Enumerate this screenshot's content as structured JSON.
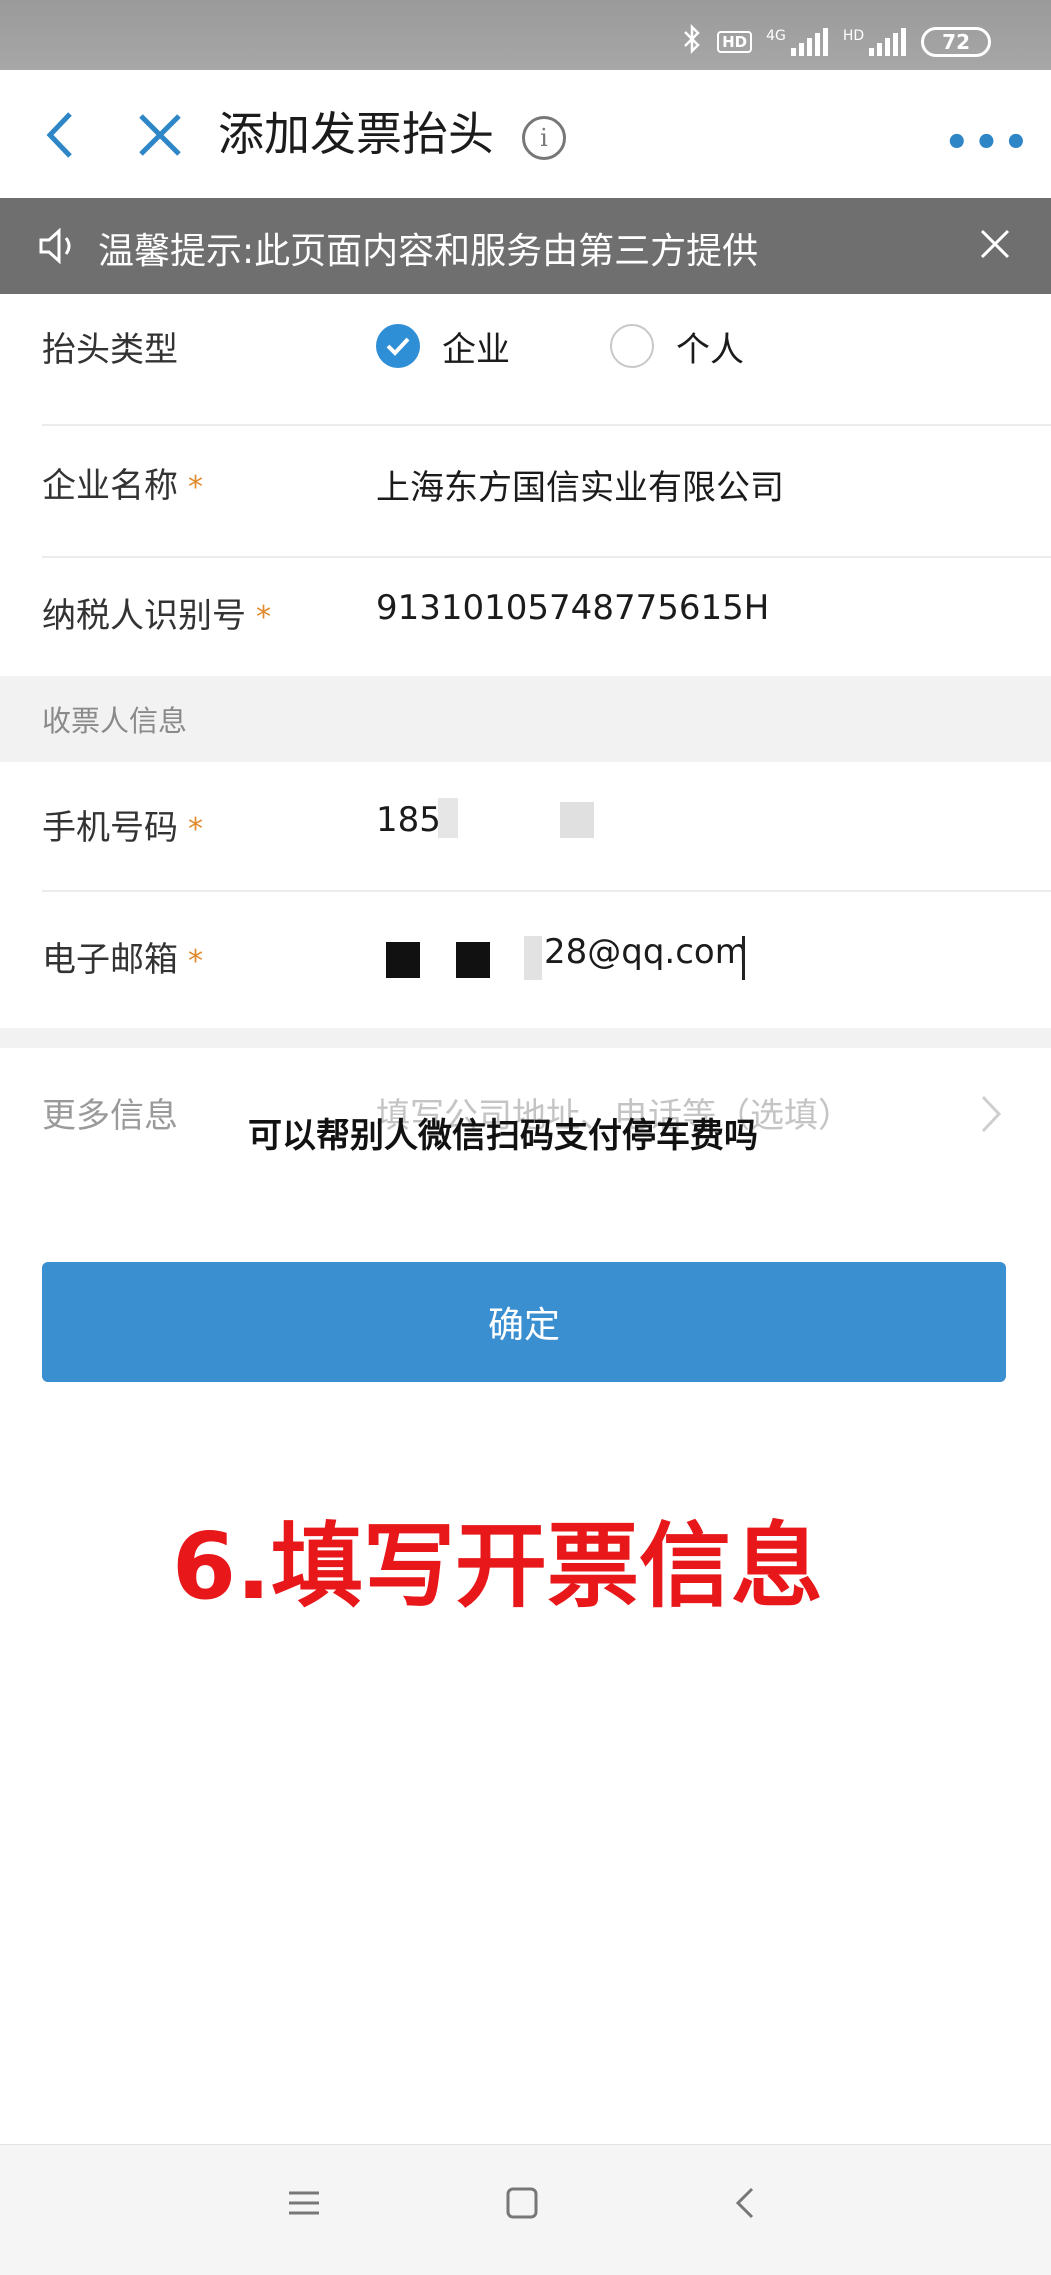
{
  "status_bar": {
    "signal1_label": "4G",
    "signal2_label": "HD",
    "hd_label": "HD",
    "battery": "72",
    "icons": [
      "bluetooth-icon",
      "hd-icon",
      "signal-icon",
      "signal-icon",
      "battery-icon"
    ]
  },
  "header": {
    "title": "添加发票抬头",
    "info_glyph": "i",
    "more_glyph": "•••"
  },
  "notice": {
    "text": "温馨提示:此页面内容和服务由第三方提供"
  },
  "form": {
    "type_label": "抬头类型",
    "option_company": "企业",
    "option_personal": "个人",
    "selected": "企业",
    "company_label": "企业名称",
    "company_value": "上海东方国信实业有限公司",
    "tax_label": "纳税人识别号",
    "tax_value": "91310105748775615H",
    "required_mark": "*"
  },
  "recipient": {
    "section_title": "收票人信息",
    "phone_label": "手机号码",
    "phone_value": "185",
    "email_label": "电子邮箱",
    "email_value": "28@qq.com"
  },
  "more_info": {
    "label": "更多信息",
    "placeholder": "填写公司地址、电话等（选填）"
  },
  "confirm_button": "确定",
  "caption": "可以帮别人微信扫码支付停车费吗",
  "step_title": "6.填写开票信息",
  "colors": {
    "accent": "#3a8fd0",
    "notice_bg": "#6f6f6f",
    "required": "#e08a2e",
    "step_title": "#e8171a"
  }
}
